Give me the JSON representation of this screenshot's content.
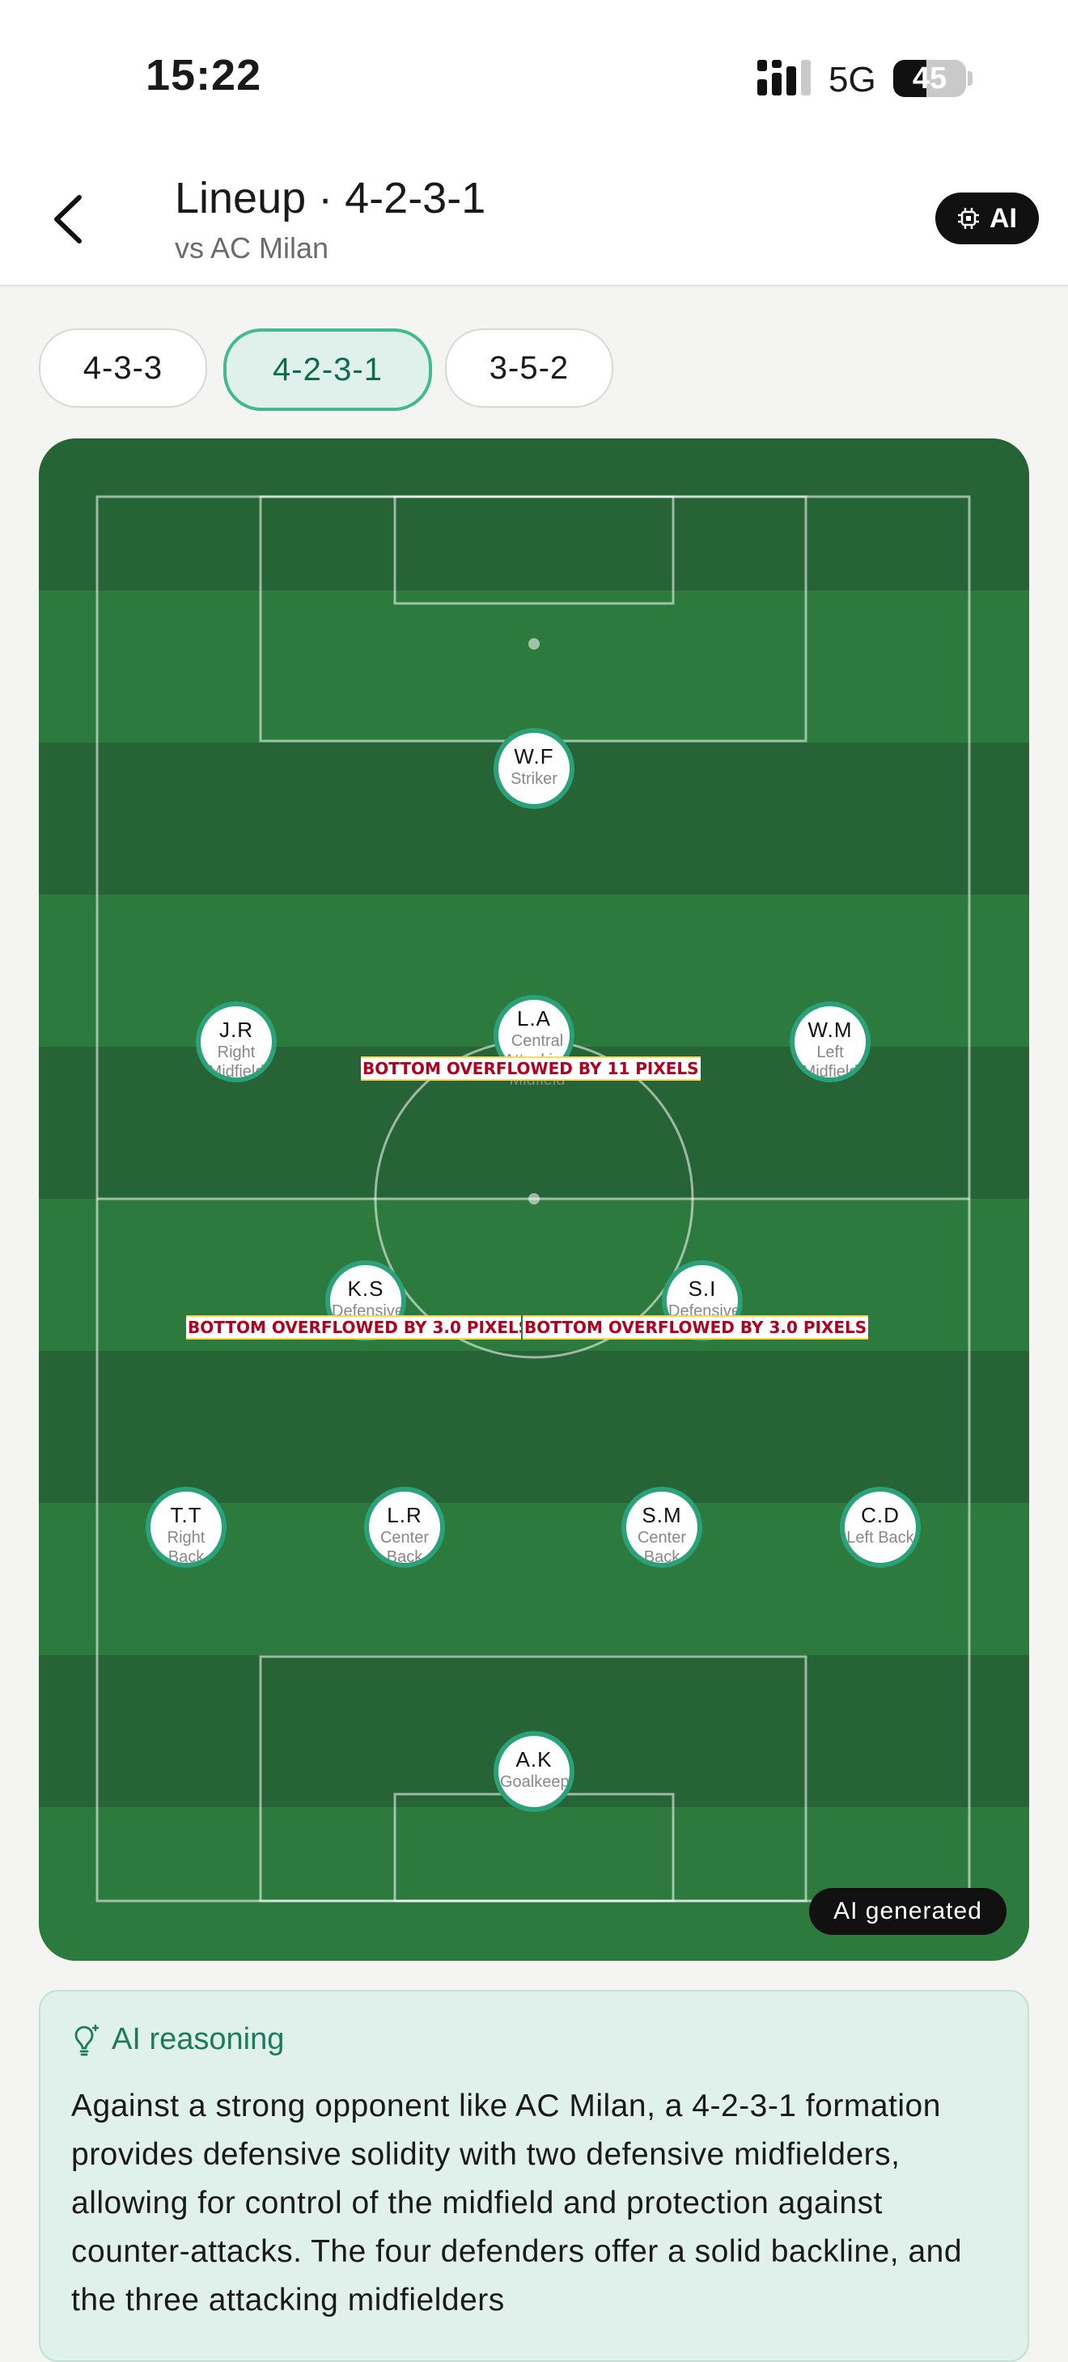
{
  "status_bar": {
    "time": "15:22",
    "network": "5G",
    "battery": "45",
    "battery_level": 0.45
  },
  "header": {
    "title": "Lineup · 4-2-3-1",
    "subtitle": "vs AC Milan",
    "ai_button": "AI"
  },
  "formations": [
    {
      "label": "4-3-3",
      "active": false
    },
    {
      "label": "4-2-3-1",
      "active": true
    },
    {
      "label": "3-5-2",
      "active": false
    }
  ],
  "players": [
    {
      "initials": "W.F",
      "role": "Striker"
    },
    {
      "initials": "J.R",
      "role": "Right Midfield"
    },
    {
      "initials": "L.A",
      "role": "Central Attacking Midfield"
    },
    {
      "initials": "W.M",
      "role": "Left Midfield"
    },
    {
      "initials": "K.S",
      "role": "Defensive"
    },
    {
      "initials": "S.I",
      "role": "Defensive"
    },
    {
      "initials": "T.T",
      "role": "Right Back"
    },
    {
      "initials": "L.R",
      "role": "Center Back"
    },
    {
      "initials": "S.M",
      "role": "Center Back"
    },
    {
      "initials": "C.D",
      "role": "Left Back"
    },
    {
      "initials": "A.K",
      "role": "Goalkeeper"
    }
  ],
  "overflow_errors": {
    "cam": "BOTTOM OVERFLOWED BY 11 PIXELS",
    "dm_left": "BOTTOM OVERFLOWED BY 3.0 PIXELS",
    "dm_right": "BOTTOM OVERFLOWED BY 3.0 PIXELS"
  },
  "pitch_badge": "AI generated",
  "reasoning": {
    "heading": "AI reasoning",
    "text": "Against a strong opponent like AC Milan, a 4-2-3-1 formation provides defensive solidity with two defensive midfielders, allowing for control of the midfield and protection against counter-attacks. The four defenders offer a solid backline, and the three attacking midfielders"
  },
  "colors": {
    "accent": "#43b892",
    "pitch_light": "#2d7a3e",
    "pitch_dark": "#266335",
    "player_ring": "#2aa178",
    "error_text": "#b00020"
  }
}
